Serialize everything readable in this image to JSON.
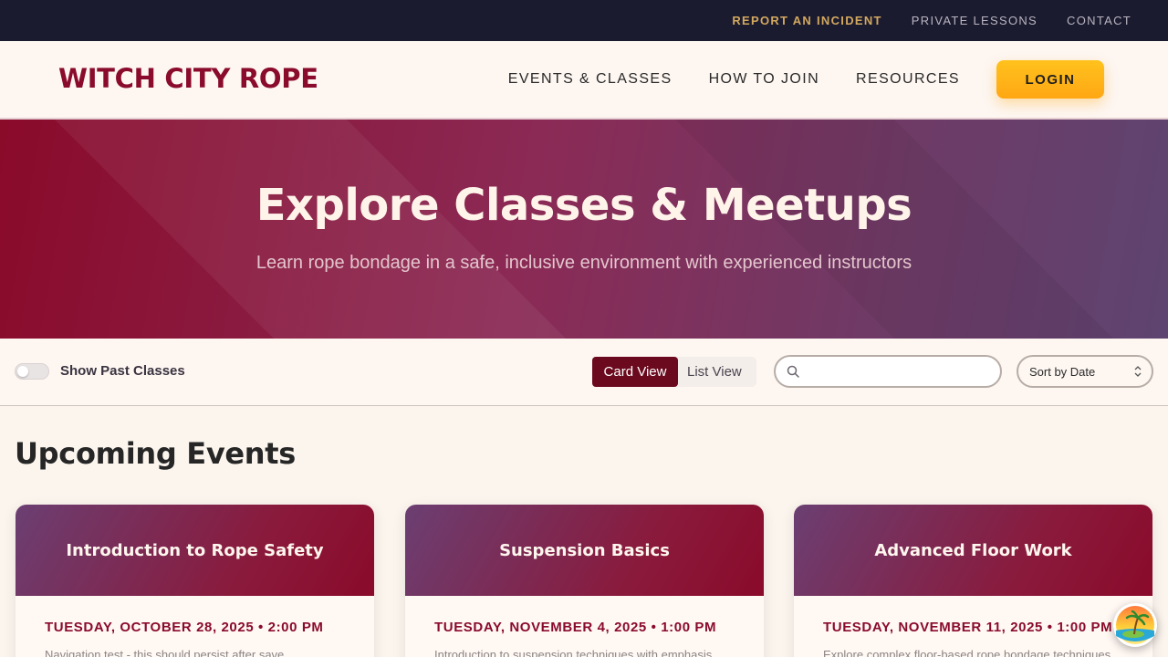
{
  "utility_nav": {
    "report_incident": "REPORT AN INCIDENT",
    "private_lessons": "PRIVATE LESSONS",
    "contact": "CONTACT"
  },
  "header": {
    "logo": "WITCH CITY ROPE",
    "nav": [
      "EVENTS & CLASSES",
      "HOW TO JOIN",
      "RESOURCES"
    ],
    "login": "LOGIN"
  },
  "hero": {
    "title": "Explore Classes & Meetups",
    "subtitle": "Learn rope bondage in a safe, inclusive environment with experienced instructors"
  },
  "filters": {
    "show_past_label": "Show Past Classes",
    "show_past_enabled": false,
    "views": [
      "Card View",
      "List View"
    ],
    "active_view": "Card View",
    "search_value": "",
    "sort_selected": "Sort by Date"
  },
  "section": {
    "title": "Upcoming Events"
  },
  "events": [
    {
      "title": "Introduction to Rope Safety",
      "date": "TUESDAY, OCTOBER 28, 2025 • 2:00 PM",
      "description": "Navigation test - this should persist after save"
    },
    {
      "title": "Suspension Basics",
      "date": "TUESDAY, NOVEMBER 4, 2025 • 1:00 PM",
      "description": "Introduction to suspension techniques with emphasis"
    },
    {
      "title": "Advanced Floor Work",
      "date": "TUESDAY, NOVEMBER 11, 2025 • 1:00 PM",
      "description": "Explore complex floor-based rope bondage techniques"
    }
  ],
  "colors": {
    "brand": "#8a0b2c",
    "accent": "#ffb81a",
    "utility_bar": "#1b1b30",
    "active_view": "#6b0a1e"
  },
  "icons": {
    "search": "search-icon",
    "sort": "sort-chevrons-icon",
    "floating_button": "beach-avatar-icon"
  }
}
